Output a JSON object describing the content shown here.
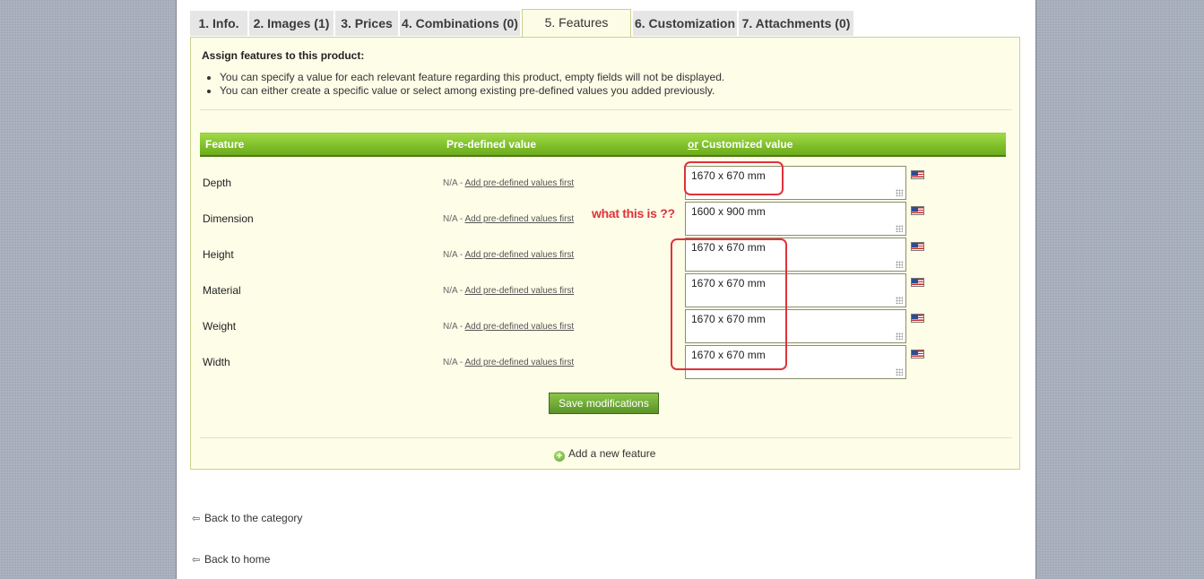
{
  "tabs": [
    {
      "label": "1. Info."
    },
    {
      "label": "2. Images (1)"
    },
    {
      "label": "3. Prices"
    },
    {
      "label": "4. Combinations (0)"
    },
    {
      "label": "5. Features"
    },
    {
      "label": "6. Customization"
    },
    {
      "label": "7. Attachments (0)"
    }
  ],
  "panel": {
    "heading": "Assign features to this product:",
    "bullets": [
      "You can specify a value for each relevant feature regarding this product, empty fields will not be displayed.",
      "You can either create a specific value or select among existing pre-defined values you added previously."
    ]
  },
  "table": {
    "col_feature": "Feature",
    "col_predefined": "Pre-defined value",
    "col_custom_or": "or",
    "col_custom": "Customized value",
    "na": "N/A",
    "na_sep": " - ",
    "add_predefined": "Add pre-defined values first",
    "rows": [
      {
        "name": "Depth",
        "value": "1670 x 670 mm"
      },
      {
        "name": "Dimension",
        "value": "1600 x 900 mm"
      },
      {
        "name": "Height",
        "value": "1670 x 670 mm"
      },
      {
        "name": "Material",
        "value": "1670 x 670 mm"
      },
      {
        "name": "Weight",
        "value": "1670 x 670 mm"
      },
      {
        "name": "Width",
        "value": "1670 x 670 mm"
      }
    ]
  },
  "annotation": "what this is ??",
  "save_button": "Save modifications",
  "add_feature": "Add a new feature",
  "back_category": "Back to the category",
  "back_home": "Back to home",
  "colors": {
    "accent_green": "#7fc12a",
    "panel_bg": "#fdfde8",
    "annotation_red": "#e0323c"
  },
  "icons": {
    "flag": "us-flag-icon",
    "add": "plus-circle-icon",
    "back": "back-arrow-icon"
  }
}
